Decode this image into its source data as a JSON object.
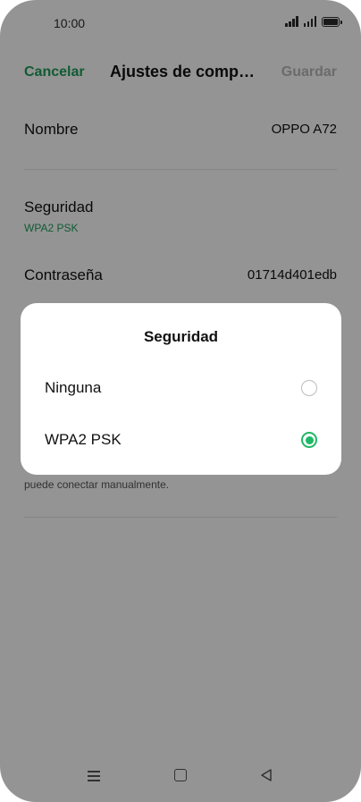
{
  "status_bar": {
    "time": "10:00",
    "icons": [
      "signal-icon",
      "signal-icon",
      "battery-icon"
    ]
  },
  "header": {
    "cancel_label": "Cancelar",
    "title": "Ajustes de comp…",
    "save_label": "Guardar"
  },
  "fields": {
    "nombre": {
      "label": "Nombre",
      "value": "OPPO A72"
    },
    "seguridad": {
      "label": "Seguridad",
      "value": "WPA2 PSK"
    },
    "contrasena": {
      "label": "Contraseña",
      "value": "01714d401edb"
    }
  },
  "hint_text": "puede conectar manualmente.",
  "dialog": {
    "title": "Seguridad",
    "options": [
      {
        "label": "Ninguna",
        "selected": false
      },
      {
        "label": "WPA2 PSK",
        "selected": true
      }
    ]
  },
  "nav_bar": {
    "icons": [
      "menu-icon",
      "home-icon",
      "back-icon"
    ]
  },
  "colors": {
    "accent": "#1e9e5a",
    "radio_selected": "#1fb866",
    "scrim": "rgba(0,0,0,0.42)"
  }
}
